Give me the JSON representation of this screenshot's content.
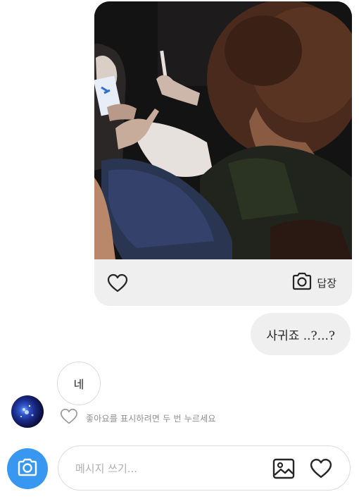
{
  "photo_message": {
    "like_icon": "heart-outline-icon",
    "reply_icon": "camera-outline-icon",
    "reply_label": "답장"
  },
  "outgoing_message": {
    "text": "사귀죠 ..?...?"
  },
  "incoming_message": {
    "text": "네"
  },
  "like_hint": {
    "icon": "heart-outline-icon",
    "text": "좋아요를 표시하려면 두 번 누르세요"
  },
  "composer": {
    "camera_icon": "camera-icon",
    "placeholder": "메시지 쓰기...",
    "gallery_icon": "image-icon",
    "like_icon": "heart-outline-icon"
  },
  "colors": {
    "accent": "#3897f0",
    "bubble": "#efefef",
    "border": "#dbdbdb",
    "muted": "#8e8e8e"
  }
}
